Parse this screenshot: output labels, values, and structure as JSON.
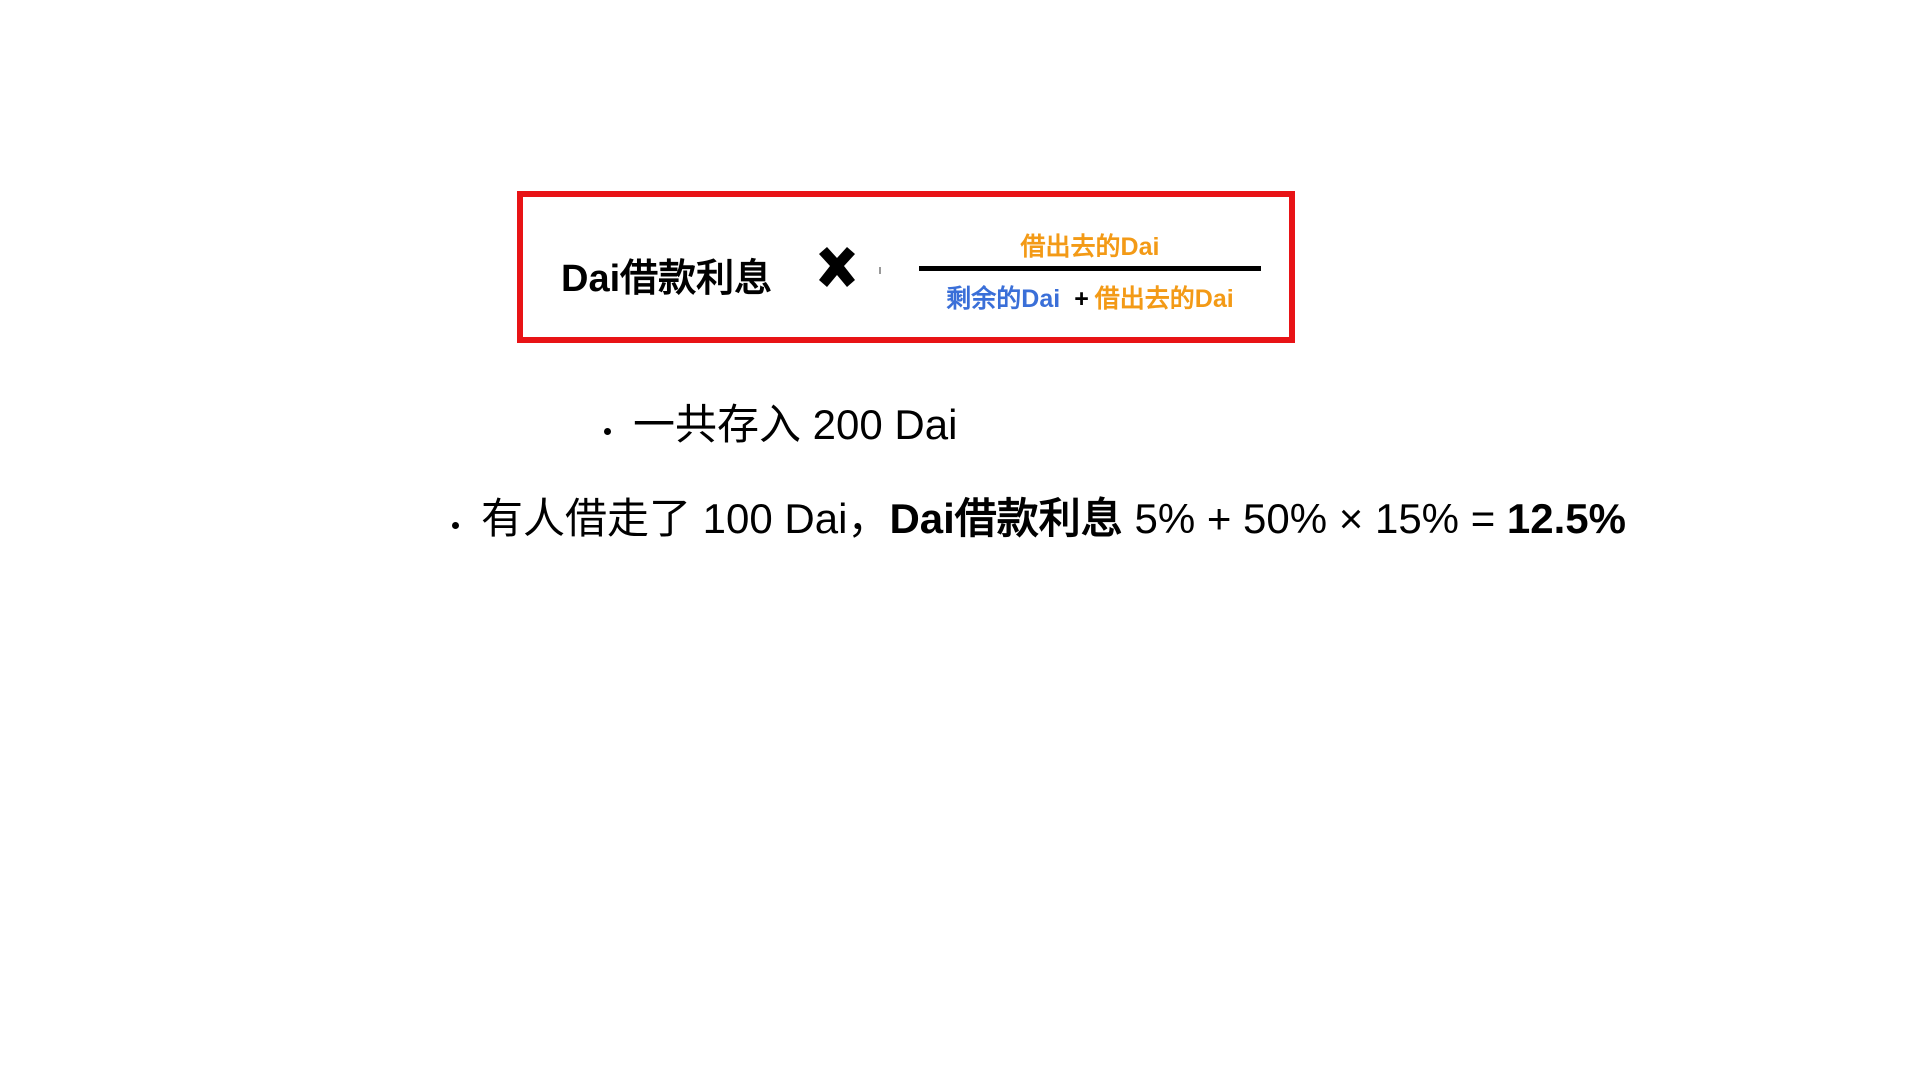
{
  "formula": {
    "label": "Dai借款利息",
    "operator_icon": "multiply-icon",
    "numerator": "借出去的Dai",
    "denominator_left": "剩余的Dai",
    "denominator_plus": "+",
    "denominator_right": "借出去的Dai",
    "colors": {
      "border": "#e81316",
      "orange": "#f39a16",
      "blue": "#3a6fd8"
    }
  },
  "bullets": [
    {
      "text": "一共存入 200 Dai"
    },
    {
      "part1": "有人借走了 100 Dai，",
      "part2_bold": "Dai借款利息",
      "part3": " 5% + 50% × 15% = ",
      "part4_bold": "12.5%"
    }
  ]
}
